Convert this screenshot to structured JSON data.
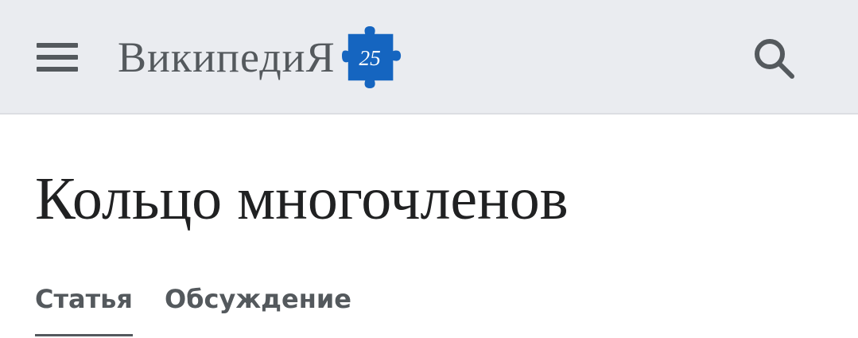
{
  "header": {
    "logo_text": "Википеди",
    "logo_text_last": "Я",
    "anniversary_badge": "25",
    "colors": {
      "background": "#eaecf0",
      "icon": "#54595d",
      "badge_blue": "#1565c0"
    },
    "menu_icon": "hamburger-icon",
    "search_icon": "search-icon"
  },
  "article": {
    "title": "Кольцо многочленов"
  },
  "tabs": [
    {
      "label": "Статья",
      "active": true
    },
    {
      "label": "Обсуждение",
      "active": false
    }
  ]
}
